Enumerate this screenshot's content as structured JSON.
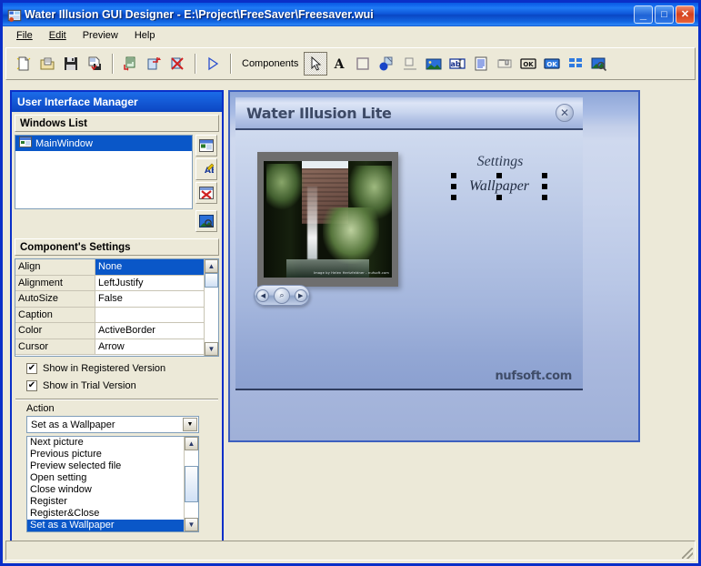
{
  "window": {
    "title": "Water Illusion GUI Designer - E:\\Project\\FreeSaver\\Freesaver.wui",
    "app_icon": "application-icon",
    "buttons": {
      "minimize": "_",
      "maximize": "□",
      "close": "✕"
    }
  },
  "menu": [
    {
      "label": "File",
      "accel": "F"
    },
    {
      "label": "Edit",
      "accel": "E"
    },
    {
      "label": "Preview",
      "accel": ""
    },
    {
      "label": "Help",
      "accel": ""
    }
  ],
  "toolbar": {
    "components_label": "Components",
    "file_group": [
      "new-file-icon",
      "open-file-icon",
      "save-icon",
      "save-as-icon"
    ],
    "edit_group": [
      "paste-icon",
      "copy-icon",
      "delete-icon"
    ],
    "run_group": [
      "run-preview-icon"
    ],
    "component_tools": [
      "pointer-icon",
      "label-text-icon",
      "panel-icon",
      "shape-icon",
      "groupbox-icon",
      "image-icon",
      "edit-box-icon",
      "memo-icon",
      "trackbar-icon",
      "button-ok-icon",
      "bitmap-button-icon",
      "grid-icon",
      "preview-image-icon"
    ],
    "active_tool": "pointer-icon"
  },
  "left_panel": {
    "caption": "User Interface Manager",
    "windows_list": {
      "header": "Windows List",
      "items": [
        {
          "label": "MainWindow",
          "selected": true
        }
      ],
      "buttons": [
        "add-window-icon",
        "rename-window-icon",
        "delete-window-icon",
        "preview-window-icon"
      ]
    },
    "component_settings": {
      "header": "Component's Settings",
      "rows": [
        {
          "name": "Align",
          "value": "None",
          "selected": true
        },
        {
          "name": "Alignment",
          "value": "LeftJustify",
          "selected": false
        },
        {
          "name": "AutoSize",
          "value": "False",
          "selected": false
        },
        {
          "name": "Caption",
          "value": "",
          "selected": false
        },
        {
          "name": "Color",
          "value": "ActiveBorder",
          "selected": false
        },
        {
          "name": "Cursor",
          "value": "Arrow",
          "selected": false
        }
      ],
      "scroll_up": "▲",
      "scroll_down": "▼"
    },
    "checkboxes": [
      {
        "label": "Show in Registered Version",
        "checked": true,
        "mark": "✔"
      },
      {
        "label": "Show in Trial Version",
        "checked": true,
        "mark": "✔"
      }
    ],
    "action": {
      "label": "Action",
      "combo_value": "Set as a Wallpaper",
      "combo_arrow": "▼",
      "options": [
        {
          "label": "Next picture",
          "selected": false
        },
        {
          "label": "Previous picture",
          "selected": false
        },
        {
          "label": "Preview selected file",
          "selected": false
        },
        {
          "label": "Open setting",
          "selected": false
        },
        {
          "label": "Close window",
          "selected": false
        },
        {
          "label": "Register",
          "selected": false
        },
        {
          "label": "Register&Close",
          "selected": false
        },
        {
          "label": "Set as a Wallpaper",
          "selected": true
        }
      ],
      "scroll_up": "▲",
      "scroll_down": "▼"
    }
  },
  "canvas": {
    "skin_window": {
      "title": "Water Illusion Lite",
      "close_glyph": "✕",
      "photo_credit": "Image by Helen Hertzfeldner - nufsoft.com",
      "nav_buttons": [
        {
          "name": "previous-picture-button",
          "glyph": "◀"
        },
        {
          "name": "zoom-button",
          "glyph": "⌕"
        },
        {
          "name": "next-picture-button",
          "glyph": "▶"
        }
      ],
      "settings_label": "Settings",
      "wallpaper_label": "Wallpaper",
      "brand": "nufsoft.com"
    }
  },
  "statusbar": {
    "text": ""
  },
  "colors": {
    "title_blue": "#0a4ec9",
    "selection_blue": "#0a57c8",
    "panel_border": "#0a2fc8",
    "face": "#ece9d8",
    "close_red": "#d4401c"
  }
}
